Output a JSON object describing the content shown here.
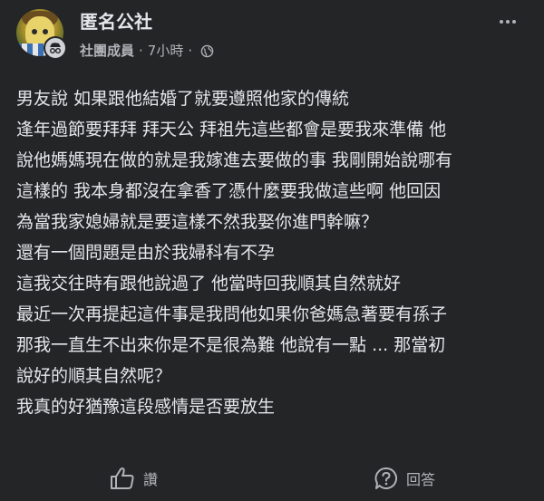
{
  "header": {
    "group_name": "匿名公社",
    "member_label": "社團成員",
    "separator": "·",
    "time": "7小時",
    "time_separator": "·",
    "privacy_icon": "globe-icon",
    "avatar_badge_icon": "incognito-icon",
    "more_icon": "more-dots-icon"
  },
  "post": {
    "lines": [
      "男友說 如果跟他結婚了就要遵照他家的傳統",
      "逢年過節要拜拜 拜天公 拜祖先這些都會是要我來準備 他",
      "說他媽媽現在做的就是我嫁進去要做的事 我剛開始說哪有",
      "這樣的 我本身都沒在拿香了憑什麼要我做這些啊 他回因",
      "為當我家媳婦就是要這樣不然我娶你進門幹嘛？",
      "還有一個問題是由於我婦科有不孕",
      "這我交往時有跟他說過了  他當時回我順其自然就好",
      "最近一次再提起這件事是我問他如果你爸媽急著要有孫子",
      "那我一直生不出來你是不是很為難 他說有一點 ...  那當初",
      "說好的順其自然呢？",
      "我真的好猶豫這段感情是否要放生"
    ]
  },
  "actions": {
    "like_label": "讚",
    "like_icon": "thumbs-up-icon",
    "comment_label": "回答",
    "comment_icon": "comment-bubble-icon"
  },
  "colors": {
    "background": "#242526",
    "text_primary": "#e4e6eb",
    "text_secondary": "#b0b3b8"
  }
}
